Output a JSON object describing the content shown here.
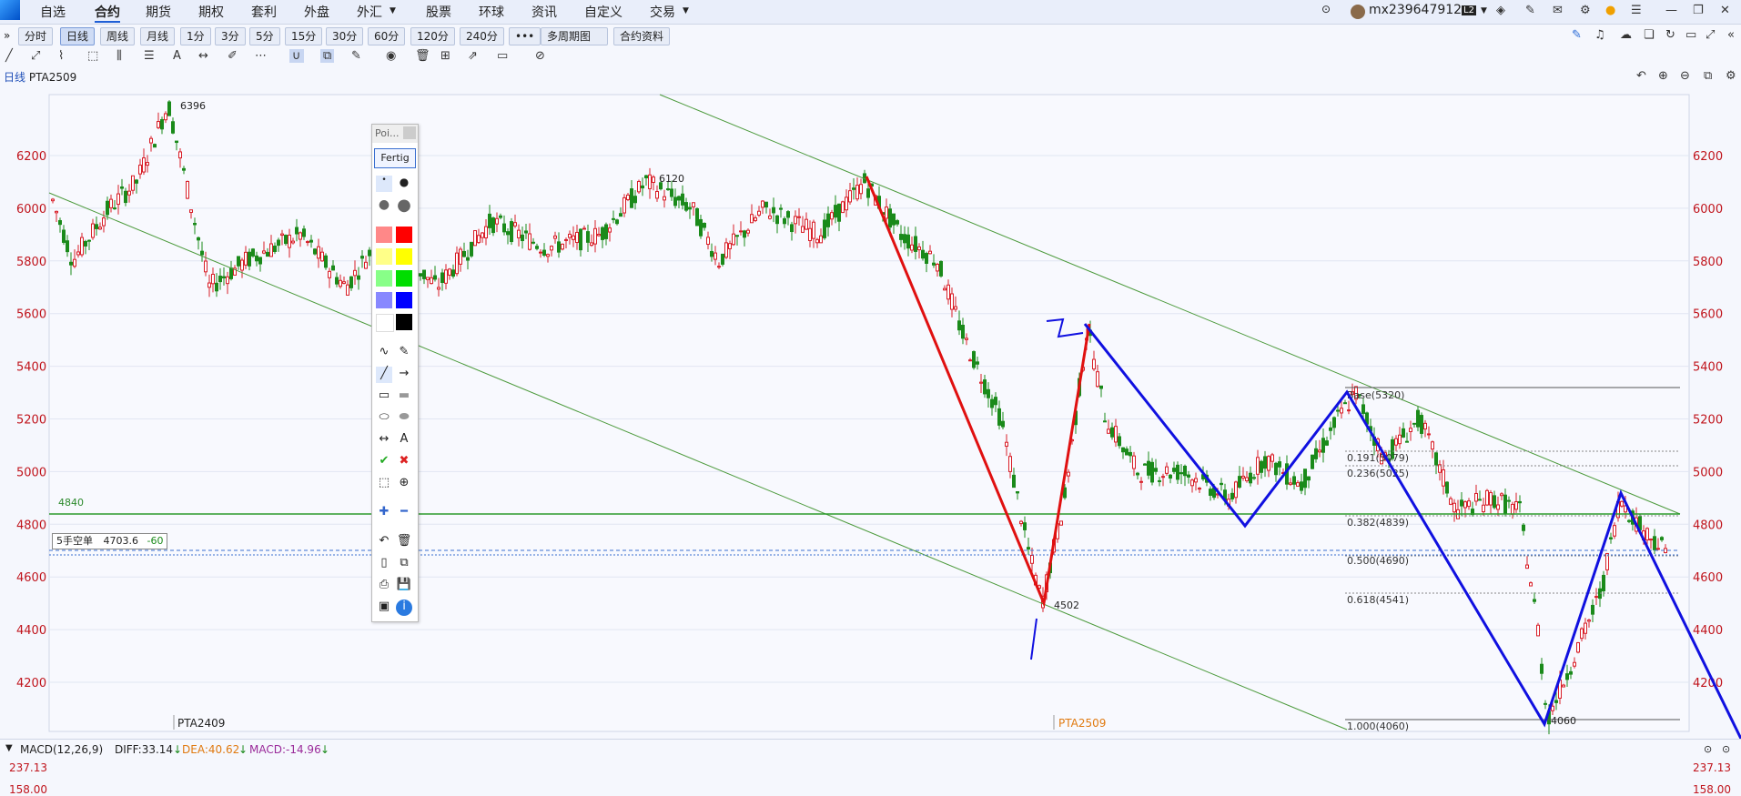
{
  "menubar": {
    "items": [
      "自选",
      "合约",
      "期货",
      "期权",
      "套利",
      "外盘",
      "外汇",
      "股票",
      "环球",
      "资讯",
      "自定义",
      "交易"
    ],
    "active": "合约",
    "username": "mx239647912",
    "level_badge": "L2"
  },
  "periods": {
    "items": [
      "分时",
      "日线",
      "周线",
      "月线",
      "1分",
      "3分",
      "5分",
      "15分",
      "30分",
      "60分",
      "120分",
      "240分",
      "•••",
      "多周期图",
      "合约资料"
    ],
    "selected": "日线",
    "expand_label": "»"
  },
  "chart_title": {
    "period": "日线",
    "symbol": "PTA2509"
  },
  "chart_data": {
    "type": "candlestick",
    "y_ticks": [
      4200,
      4400,
      4600,
      4800,
      5000,
      5200,
      5400,
      5600,
      5800,
      6000,
      6200
    ],
    "price_annotations": [
      "6396",
      "6120",
      "4502",
      "4060"
    ],
    "hline_label": "4840",
    "fib_levels": [
      "Base(5320)",
      "0.191(5079)",
      "0.236(5025)",
      "0.382(4839)",
      "0.500(4690)",
      "0.618(4541)",
      "1.000(4060)"
    ],
    "contract_labels": [
      "PTA2409",
      "PTA2509"
    ]
  },
  "position_panel": {
    "label": "5手空单",
    "price": "4703.6",
    "pnl": "-60"
  },
  "palette": {
    "title": "Poi...",
    "done_label": "Fertig"
  },
  "macd": {
    "name": "MACD(12,26,9)",
    "diff": "DIFF:33.14",
    "dea": "DEA:40.62",
    "macd": "MACD:-14.96",
    "top_value": "237.13",
    "next_value": "158.00"
  },
  "colors": {
    "up": "#d81e28",
    "down": "#1a8a1a",
    "trend_red": "#e01010",
    "trend_blue": "#1010e0",
    "channel": "#4c9a3c"
  }
}
